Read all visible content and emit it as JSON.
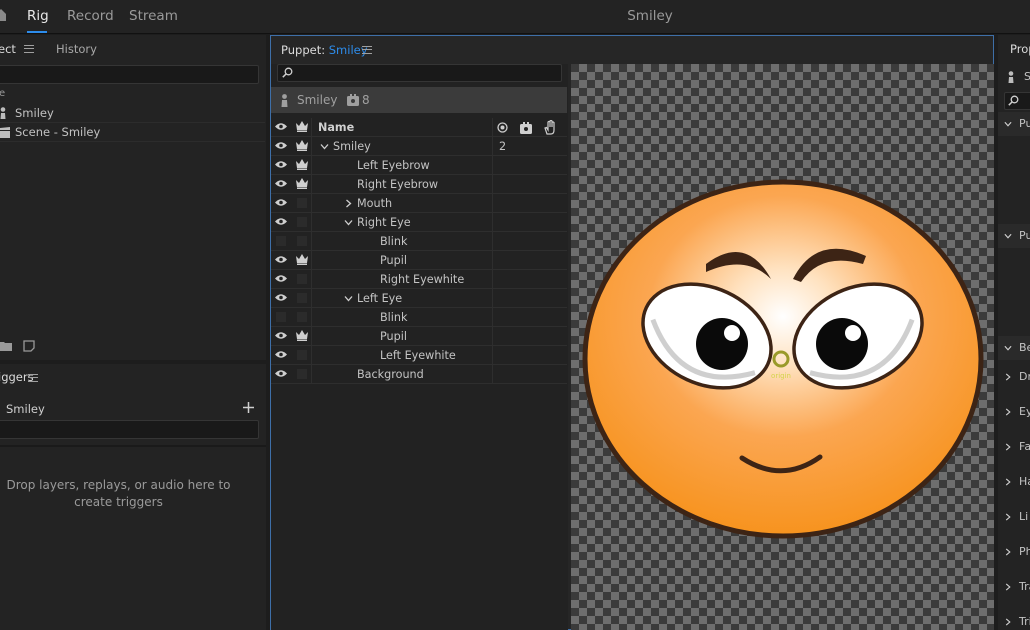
{
  "app": {
    "title": "Smiley"
  },
  "workspace_tabs": [
    {
      "label": "Rig",
      "active": true
    },
    {
      "label": "Record",
      "active": false
    },
    {
      "label": "Stream",
      "active": false
    }
  ],
  "project_panel": {
    "tabs": [
      "ect",
      "History"
    ],
    "column_fragment": "e",
    "items": [
      {
        "label": "Smiley",
        "icon": "puppet-icon"
      },
      {
        "label": "Scene - Smiley",
        "icon": "scene-icon"
      }
    ]
  },
  "triggers_panel": {
    "title": "iggers",
    "puppet_name": "Smiley",
    "empty_text_line1": "Drop layers, replays, or audio here to",
    "empty_text_line2": "create triggers"
  },
  "puppet_panel": {
    "title_prefix": "Puppet:",
    "title_name": "Smiley",
    "info": {
      "puppet": "Smiley",
      "behavior_count": "8"
    },
    "column_name": "Name",
    "layers": [
      {
        "name": "Smiley",
        "visible": true,
        "crown": true,
        "indent": 1,
        "expander": "down",
        "count": "2"
      },
      {
        "name": "Left Eyebrow",
        "visible": true,
        "crown": true,
        "indent": 2,
        "expander": ""
      },
      {
        "name": "Right Eyebrow",
        "visible": true,
        "crown": true,
        "indent": 2,
        "expander": ""
      },
      {
        "name": "Mouth",
        "visible": true,
        "crown": false,
        "indent": 2,
        "expander": "right"
      },
      {
        "name": "Right Eye",
        "visible": true,
        "crown": false,
        "indent": 2,
        "expander": "down"
      },
      {
        "name": "Blink",
        "visible": false,
        "crown": false,
        "indent": 3,
        "expander": ""
      },
      {
        "name": "Pupil",
        "visible": true,
        "crown": true,
        "indent": 3,
        "expander": ""
      },
      {
        "name": "Right Eyewhite",
        "visible": true,
        "crown": false,
        "indent": 3,
        "expander": ""
      },
      {
        "name": "Left Eye",
        "visible": true,
        "crown": false,
        "indent": 2,
        "expander": "down"
      },
      {
        "name": "Blink",
        "visible": false,
        "crown": false,
        "indent": 3,
        "expander": ""
      },
      {
        "name": "Pupil",
        "visible": true,
        "crown": true,
        "indent": 3,
        "expander": ""
      },
      {
        "name": "Left Eyewhite",
        "visible": true,
        "crown": false,
        "indent": 3,
        "expander": ""
      },
      {
        "name": "Background",
        "visible": true,
        "crown": false,
        "indent": 2,
        "expander": ""
      }
    ],
    "origin_label": "origin"
  },
  "properties_panel": {
    "title": "Prop",
    "puppet_initial": "S",
    "sections": [
      {
        "label": "Pu",
        "expanded": true
      },
      {
        "label": "Pu",
        "expanded": true
      },
      {
        "label": "Be",
        "expanded": true
      },
      {
        "label": "Dr",
        "expanded": false
      },
      {
        "label": "Ey",
        "expanded": false
      },
      {
        "label": "Fa",
        "expanded": false
      },
      {
        "label": "Ha",
        "expanded": false
      },
      {
        "label": "Li",
        "expanded": false
      },
      {
        "label": "Ph",
        "expanded": false
      },
      {
        "label": "Tra",
        "expanded": false
      },
      {
        "label": "Tri",
        "expanded": false
      }
    ]
  },
  "colors": {
    "accent": "#2d8ceb",
    "face": "#f7931e",
    "face_outline": "#3d2415"
  }
}
